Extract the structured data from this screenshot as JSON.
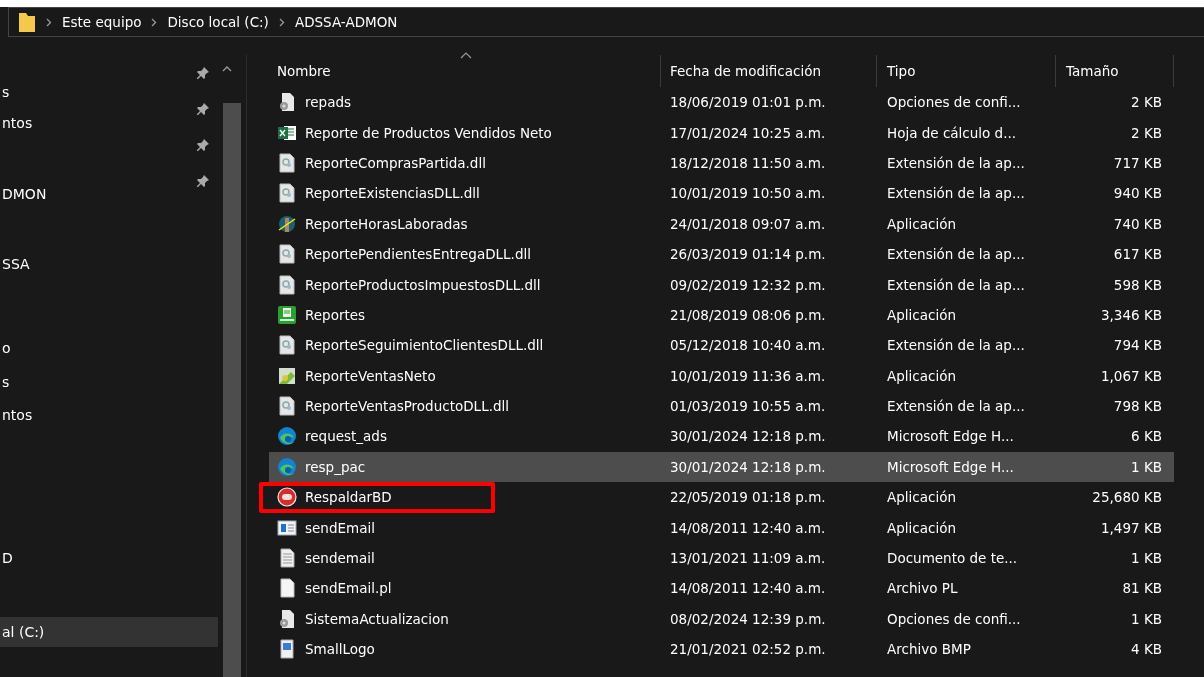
{
  "address_bar": {
    "segments": [
      "Este equipo",
      "Disco local (C:)",
      "ADSSA-ADMON"
    ]
  },
  "sidebar": {
    "items": [
      {
        "label": "s",
        "selected": false
      },
      {
        "label": "ntos",
        "selected": false
      },
      {
        "label": "DMON",
        "selected": false
      },
      {
        "label": "SSA",
        "selected": false
      },
      {
        "label": "o",
        "selected": false
      },
      {
        "label": "s",
        "selected": false
      },
      {
        "label": "ntos",
        "selected": false
      },
      {
        "label": "D",
        "selected": false
      },
      {
        "label": "al (C:)",
        "selected": true
      }
    ]
  },
  "table": {
    "columns": [
      "Nombre",
      "Fecha de modificación",
      "Tipo",
      "Tamaño"
    ],
    "rows": [
      {
        "kind": "config",
        "name": "repads",
        "date": "18/06/2019 01:01 p.m.",
        "type": "Opciones de confi...",
        "size": "2 KB",
        "selected": false,
        "highlighted": false
      },
      {
        "kind": "sheet",
        "name": "Reporte de Productos Vendidos Neto",
        "date": "17/01/2024 10:25 a.m.",
        "type": "Hoja de cálculo d...",
        "size": "2 KB",
        "selected": false,
        "highlighted": false
      },
      {
        "kind": "dll",
        "name": "ReporteComprasPartida.dll",
        "date": "18/12/2018 11:50 a.m.",
        "type": "Extensión de la ap...",
        "size": "717 KB",
        "selected": false,
        "highlighted": false
      },
      {
        "kind": "dll",
        "name": "ReporteExistenciasDLL.dll",
        "date": "10/01/2019 10:50 a.m.",
        "type": "Extensión de la ap...",
        "size": "940 KB",
        "selected": false,
        "highlighted": false
      },
      {
        "kind": "clock",
        "name": "ReporteHorasLaboradas",
        "date": "24/01/2018 09:07 a.m.",
        "type": "Aplicación",
        "size": "740 KB",
        "selected": false,
        "highlighted": false
      },
      {
        "kind": "dll",
        "name": "ReportePendientesEntregaDLL.dll",
        "date": "26/03/2019 01:14 p.m.",
        "type": "Extensión de la ap...",
        "size": "617 KB",
        "selected": false,
        "highlighted": false
      },
      {
        "kind": "dll",
        "name": "ReporteProductosImpuestosDLL.dll",
        "date": "09/02/2019 12:32 p.m.",
        "type": "Extensión de la ap...",
        "size": "598 KB",
        "selected": false,
        "highlighted": false
      },
      {
        "kind": "report",
        "name": "Reportes",
        "date": "21/08/2019 08:06 p.m.",
        "type": "Aplicación",
        "size": "3,346 KB",
        "selected": false,
        "highlighted": false
      },
      {
        "kind": "dll",
        "name": "ReporteSeguimientoClientesDLL.dll",
        "date": "05/12/2018 10:40 a.m.",
        "type": "Extensión de la ap...",
        "size": "794 KB",
        "selected": false,
        "highlighted": false
      },
      {
        "kind": "money",
        "name": "ReporteVentasNeto",
        "date": "10/01/2019 11:36 a.m.",
        "type": "Aplicación",
        "size": "1,067 KB",
        "selected": false,
        "highlighted": false
      },
      {
        "kind": "dll",
        "name": "ReporteVentasProductoDLL.dll",
        "date": "01/03/2019 10:55 a.m.",
        "type": "Extensión de la ap...",
        "size": "798 KB",
        "selected": false,
        "highlighted": false
      },
      {
        "kind": "edge",
        "name": "request_ads",
        "date": "30/01/2024 12:18 p.m.",
        "type": "Microsoft Edge H...",
        "size": "6 KB",
        "selected": false,
        "highlighted": false
      },
      {
        "kind": "edge",
        "name": "resp_pac",
        "date": "30/01/2024 12:18 p.m.",
        "type": "Microsoft Edge H...",
        "size": "1 KB",
        "selected": true,
        "highlighted": false
      },
      {
        "kind": "dx",
        "name": "RespaldarBD",
        "date": "22/05/2019 01:18 p.m.",
        "type": "Aplicación",
        "size": "25,680 KB",
        "selected": false,
        "highlighted": true
      },
      {
        "kind": "win",
        "name": "sendEmail",
        "date": "14/08/2011 12:40 a.m.",
        "type": "Aplicación",
        "size": "1,497 KB",
        "selected": false,
        "highlighted": false
      },
      {
        "kind": "text",
        "name": "sendemail",
        "date": "13/01/2021 11:09 a.m.",
        "type": "Documento de te...",
        "size": "1 KB",
        "selected": false,
        "highlighted": false
      },
      {
        "kind": "blank",
        "name": "sendEmail.pl",
        "date": "14/08/2011 12:40 a.m.",
        "type": "Archivo PL",
        "size": "81 KB",
        "selected": false,
        "highlighted": false
      },
      {
        "kind": "config",
        "name": "SistemaActualizacion",
        "date": "08/02/2024 12:39 p.m.",
        "type": "Opciones de confi...",
        "size": "1 KB",
        "selected": false,
        "highlighted": false
      },
      {
        "kind": "image",
        "name": "SmallLogo",
        "date": "21/01/2021 02:52 p.m.",
        "type": "Archivo BMP",
        "size": "4 KB",
        "selected": false,
        "highlighted": false
      }
    ]
  }
}
